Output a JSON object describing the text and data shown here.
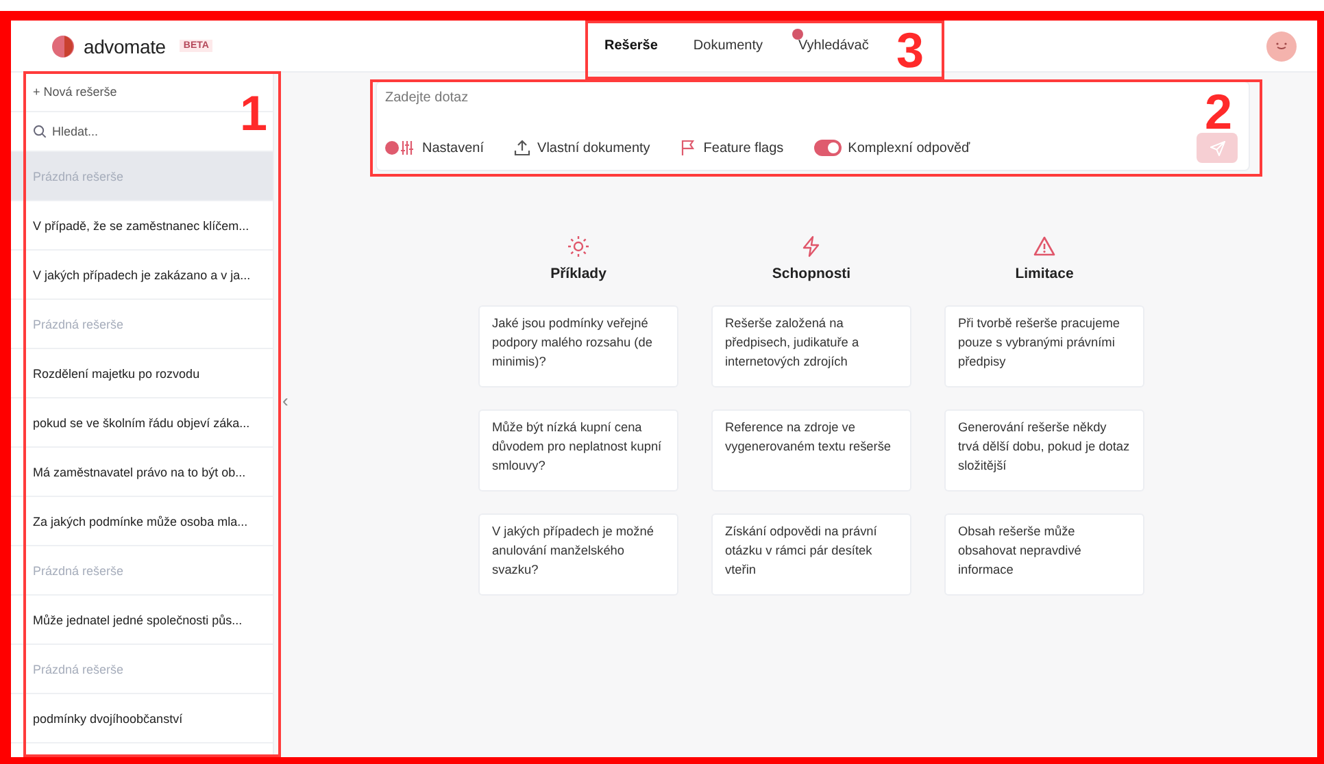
{
  "header": {
    "logo": "advomate",
    "badge": "BETA",
    "tabs": [
      {
        "label": "Rešerše",
        "selected": true,
        "dot": false
      },
      {
        "label": "Dokumenty",
        "selected": false,
        "dot": false
      },
      {
        "label": "Vyhledávač",
        "selected": false,
        "dot": true
      }
    ]
  },
  "sidebar": {
    "new_button": "+ Nová rešerše",
    "search": {
      "placeholder": "Hledat..."
    },
    "items": [
      {
        "label": "Prázdná rešerše",
        "kind": "empty",
        "selected": true
      },
      {
        "label": "V případě, že se zaměstnanec klíčem...",
        "kind": "query",
        "selected": false
      },
      {
        "label": "V jakých případech je zakázano a v ja...",
        "kind": "query",
        "selected": false
      },
      {
        "label": "Prázdná rešerše",
        "kind": "empty",
        "selected": false
      },
      {
        "label": "Rozdělení majetku po rozvodu",
        "kind": "query",
        "selected": false
      },
      {
        "label": "pokud se ve školním řádu objeví záka...",
        "kind": "query",
        "selected": false
      },
      {
        "label": "Má zaměstnavatel právo na to být ob...",
        "kind": "query",
        "selected": false
      },
      {
        "label": "Za jakých podmínke může osoba mla...",
        "kind": "query",
        "selected": false
      },
      {
        "label": "Prázdná rešerše",
        "kind": "empty",
        "selected": false
      },
      {
        "label": "Může jednatel jedné společnosti půs...",
        "kind": "query",
        "selected": false
      },
      {
        "label": "Prázdná rešerše",
        "kind": "empty",
        "selected": false
      },
      {
        "label": "podmínky dvojíhoobčanství",
        "kind": "query",
        "selected": false
      }
    ]
  },
  "collapse": "‹",
  "query": {
    "placeholder": "Zadejte dotaz",
    "tools": [
      {
        "kind": "settings",
        "label": "Nastavení"
      },
      {
        "kind": "upload",
        "label": "Vlastní dokumenty"
      },
      {
        "kind": "flag",
        "label": "Feature flags"
      },
      {
        "kind": "toggle",
        "label": "Komplexní odpověď",
        "on": true
      }
    ]
  },
  "sections": [
    {
      "kind": "sun",
      "title": "Příklady",
      "cards": [
        "Jaké jsou podmínky veřejné podpory malého rozsahu (de minimis)?",
        "Může být nízká kupní cena důvodem pro neplatnost kupní smlouvy?",
        "V jakých případech je možné anulování manželského svazku?"
      ]
    },
    {
      "kind": "bolt",
      "title": "Schopnosti",
      "cards": [
        "Rešerše založená na předpisech, judikatuře a internetových zdrojích",
        "Reference na zdroje ve vygenerovaném textu rešerše",
        "Získání odpovědi na právní otázku v rámci pár desítek vteřin"
      ]
    },
    {
      "kind": "warning",
      "title": "Limitace",
      "cards": [
        "Při tvorbě rešerše pracujeme pouze s vybranými právními předpisy",
        "Generování rešerše někdy trvá dělší dobu, pokud je dotaz složitější",
        "Obsah rešerše může obsahovat nepravdivé informace"
      ]
    }
  ],
  "annotations": [
    {
      "label": "1"
    },
    {
      "label": "2"
    },
    {
      "label": "3"
    }
  ]
}
